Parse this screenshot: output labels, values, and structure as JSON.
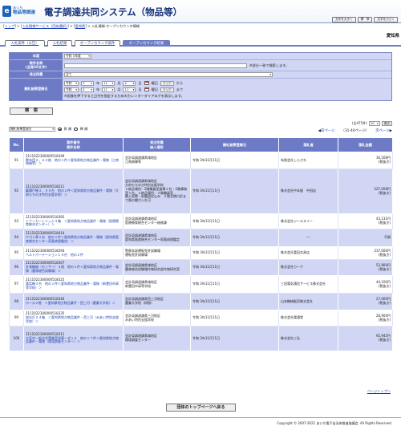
{
  "header": {
    "logo_top": "あいち",
    "logo_bottom": "物品等調達",
    "system_title": "電子調達共同システム（物品等）",
    "buttons": [
      "文字を大きく",
      "標　準",
      "文字を小さく"
    ]
  },
  "breadcrumb": {
    "items": [
      "トップ",
      "入札情報サービス（団体選択）",
      "愛知県",
      "入札情報-オープンカウンタ情報"
    ],
    "separators": [
      " > ",
      "] > [",
      "] > "
    ]
  },
  "prefecture": "愛知県",
  "tabs": [
    "入札案件（公告）",
    "入札結果",
    "オープンカウンタ案件",
    "オープンカウンタ結果"
  ],
  "search": {
    "year_label": "年度",
    "year_value": "令和 3年度",
    "case_name_label": "案件名称",
    "case_name_sub": "(全角50文字)",
    "case_name_hint": "※部分一致で検索します。",
    "org_label": "発注所属",
    "org_value": "全て",
    "date_label": "開札結果登録日",
    "from": {
      "era": "令和",
      "y": "3",
      "m": "11",
      "d": "4",
      "btn": "表",
      "day": "曜日",
      "clear": "クリア",
      "suffix": "から"
    },
    "to": {
      "era": "令和",
      "y": "3",
      "m": "11",
      "d": "11",
      "btn": "表",
      "day": "曜日",
      "clear": "クリア",
      "suffix": "まで"
    },
    "date_hint": "※画像を押下すると日付を指定するためのカレンダーダイアログを表示します。",
    "search_button": "検　索"
  },
  "list_controls": {
    "sort_value": "開札結果登録日",
    "asc_label": "昇 順",
    "desc_label": "降 順",
    "count_text": "(全475件)",
    "per_page": "10",
    "display_button": "表示",
    "prev_label": "前ページ",
    "page_info": "（31-40ページ）",
    "next_label": "次ページ"
  },
  "table": {
    "headers": [
      "No.",
      "案件番号\n案件名称",
      "発注所属\n納入場所",
      "開札結果登録日",
      "落札者",
      "落札金額"
    ],
    "rows": [
      {
        "no": "91",
        "id": "2111022300000518349",
        "name": "敷布団２，６０枚　他の１件＜愛知県地方物品業件・電線（江南病棟等）＞",
        "org": "会計局調達課県域地区\n江南病棟等",
        "date": "令和 3年11月11日",
        "winner": "有限会社しらさわ",
        "amount": "36,508円",
        "tax": "(税抜き)"
      },
      {
        "no": "92",
        "id": "2111022300000518211",
        "name": "蓄積戸棚３，５０台　他の２件＜愛知県地方物品業件・電線（大府もちのき特別支援学校）＞",
        "org": "会計局調達課県域地区\n大府もちのき特別支援学校\n１納品場所：2階職員室倉庫２台・2階事務室１台、２納品場所：２階職員室\n搬入設置・耐震固定込み　２階北側付近まで奥の棚が入れ可",
        "date": "令和 3年11月11日",
        "winner": "株式会社中本屋　中田店",
        "amount": "227,008円",
        "tax": "(税抜き)"
      },
      {
        "no": "93",
        "id": "2111022300000518395",
        "name": "トナーカートリッジ３箱　＜愛知県地方物品業件・電線（医療療育総合センター）＞",
        "org": "会計局調達課県域地区\n医療療育総合センター総務課",
        "date": "令和 3年11月11日",
        "winner": "株式会社ジーエスイー",
        "amount": "43,131円",
        "tax": "(税抜き)"
      },
      {
        "no": "94",
        "id": "2111022300000518414",
        "name": "ワゴン車１台　他の１件＜愛知県地方物品業件・電線（愛知県畜産総合センター家畜病理鑑定）＞",
        "org": "会計局調達課県域地区\n愛知県畜産総合センター家畜病理鑑定",
        "date": "令和 3年11月11日",
        "winner": "―",
        "amount": "不調",
        "tax": ""
      },
      {
        "no": "95",
        "id": "2111022300000518294",
        "name": "ベルトパーテーション１５台　他の２件",
        "org": "警察本部運転免許試験場\n運転免許試験場",
        "date": "令和 3年11月11日",
        "winner": "株式会社富田文具店",
        "amount": "237,000円",
        "tax": "(税抜き)"
      },
      {
        "no": "96",
        "id": "2111022300000518307",
        "name": "計測機器（センサー）４個　他の１件＜愛知県地方物品業件・電線（農林総合試験場）＞",
        "org": "会計局調達課県域地区\n農林総合試験場作物研究部作物研究室",
        "date": "令和 3年11月11日",
        "winner": "株式会社カーク",
        "amount": "52,800円",
        "tax": "(税抜き)"
      },
      {
        "no": "97",
        "id": "2111022300000518325",
        "name": "電話機３台　他の１件＜愛知県地方物品業件・電線（新豊田市高等学校）＞",
        "org": "会計局調達課県域地区\n新豊田市高等学校",
        "date": "令和 3年11月11日",
        "winner": "三田電気通信サービス株式会社",
        "amount": "44,100円",
        "tax": "(税抜き)"
      },
      {
        "no": "98",
        "id": "2111022300000518340",
        "name": "ホース２巻　＜愛知県地方物品業件・西三河（農業大学校）＞",
        "org": "会計局調達課県西三河地区\n農業大学校（研修）",
        "date": "令和 3年11月11日",
        "winner": "山本機械販売株式会社",
        "amount": "27,060円",
        "tax": "(税抜き)"
      },
      {
        "no": "99",
        "id": "2111022300000518335",
        "name": "蛍光灯２４箱　＜愛知県地方物品業件・西三河（みあい特別支援学校）＞",
        "org": "会計局調達課県三河地区\nみあい特別支援学校",
        "date": "令和 3年11月11日",
        "winner": "株式会社電通堂",
        "amount": "28,900円",
        "tax": "(税抜き)"
      },
      {
        "no": "100",
        "id": "2111022300000518311",
        "name": "大気中一般化学実験室試薬一式１４　他の１７件＜愛知県地方物品業件・電線（環境調査センター）＞",
        "org": "会計局調達課県域地区\n環境調査センター",
        "date": "令和 3年11月11日",
        "winner": "株式会社三弘",
        "amount": "92,945円",
        "tax": "(税抜き)"
      }
    ]
  },
  "page_top_link": "ページトップへ",
  "back_button": "団体のトップページへ戻る",
  "footer": "Copyright © 2007-2021 あいち電子自治体推進協議会. All Rights Reserved."
}
